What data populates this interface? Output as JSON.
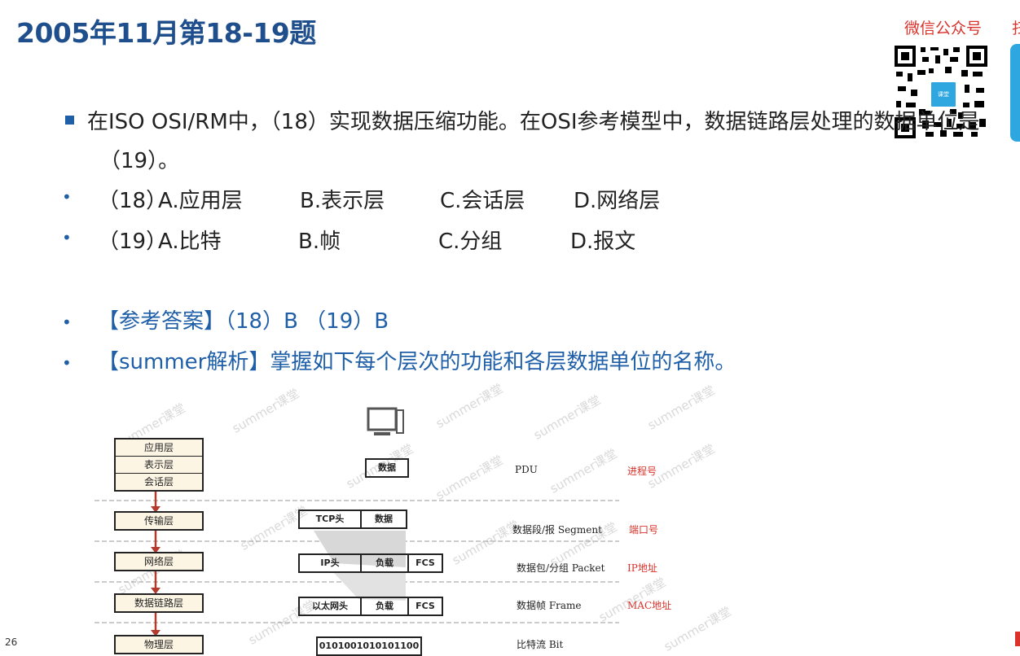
{
  "title": "2005年11月第18-19题",
  "wechat": {
    "label": "微信公众号",
    "label_cut": "扫",
    "logo_text": "课堂"
  },
  "question": {
    "line1": "在ISO OSI/RM中，（18）实现数据压缩功能。在OSI参考模型中，数据链路层处理的数据单位是",
    "line2": "（19）。"
  },
  "options": [
    {
      "num": "（18）",
      "items": [
        "A.应用层",
        "B.表示层",
        "C.会话层",
        "D.网络层"
      ]
    },
    {
      "num": "（19）",
      "items": [
        "A.比特",
        "B.帧",
        "C.分组",
        "D.报文"
      ]
    }
  ],
  "answer": "【参考答案】（18）B （19）B",
  "analysis": "【summer解析】掌握如下每个层次的功能和各层数据单位的名称。",
  "page_number": "26",
  "diagram": {
    "layers": [
      "应用层",
      "表示层",
      "会话层",
      "传输层",
      "网络层",
      "数据链路层",
      "物理层"
    ],
    "pdu_rows": [
      {
        "cells": [
          "数据"
        ],
        "name": "PDU",
        "addr": "进程号"
      },
      {
        "cells": [
          "TCP头",
          "数据"
        ],
        "name": "数据段/报 Segment",
        "addr": "端口号"
      },
      {
        "cells": [
          "IP头",
          "负载",
          "FCS"
        ],
        "name": "数据包/分组 Packet",
        "addr": "IP地址"
      },
      {
        "cells": [
          "以太网头",
          "负载",
          "FCS"
        ],
        "name": "数据帧 Frame",
        "addr": "MAC地址"
      },
      {
        "cells": [
          "0101001010101100"
        ],
        "name": "比特流 Bit",
        "addr": ""
      }
    ],
    "watermark": "summer课堂",
    "colors": {
      "addr": "#d9332b",
      "arrow": "#c0392b",
      "title": "#1f4e8c",
      "answer": "#1f5fa8"
    }
  }
}
